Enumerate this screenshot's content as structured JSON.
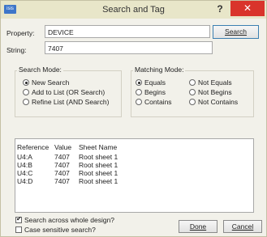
{
  "window": {
    "icon_text": "isis",
    "title": "Search and Tag",
    "help_label": "?",
    "close_label": "✕"
  },
  "property": {
    "label": "Property:",
    "value": "DEVICE"
  },
  "string": {
    "label": "String:",
    "value": "7407"
  },
  "search_button": "Search",
  "search_mode": {
    "title": "Search Mode:",
    "options": [
      "New Search",
      "Add to List (OR Search)",
      "Refine List (AND Search)"
    ],
    "selected": "New Search"
  },
  "matching_mode": {
    "title": "Matching Mode:",
    "options": [
      "Equals",
      "Not Equals",
      "Begins",
      "Not Begins",
      "Contains",
      "Not Contains"
    ],
    "selected": "Equals"
  },
  "results": {
    "columns": [
      "Reference",
      "Value",
      "Sheet Name"
    ],
    "rows": [
      [
        "U4:A",
        "7407",
        "Root sheet 1"
      ],
      [
        "U4:B",
        "7407",
        "Root sheet 1"
      ],
      [
        "U4:C",
        "7407",
        "Root sheet 1"
      ],
      [
        "U4:D",
        "7407",
        "Root sheet 1"
      ]
    ]
  },
  "options": {
    "search_whole_design": {
      "label": "Search across whole design?",
      "checked": true
    },
    "case_sensitive": {
      "label": "Case sensitive search?",
      "checked": false
    }
  },
  "done_button": "Done",
  "cancel_button": "Cancel"
}
